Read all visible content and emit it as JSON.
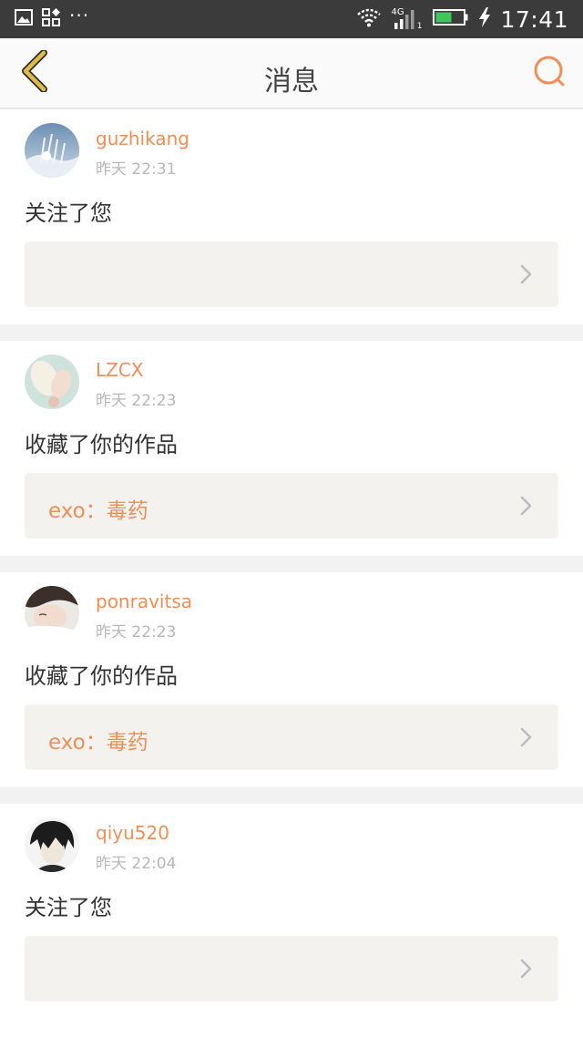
{
  "status_bar": {
    "time": "17:41",
    "dots": "···",
    "network": "4G",
    "sim": "1"
  },
  "header": {
    "title": "消息"
  },
  "messages": [
    {
      "username": "guzhikang",
      "time": "昨天 22:31",
      "action": "关注了您",
      "work_title": ""
    },
    {
      "username": "LZCX",
      "time": "昨天 22:23",
      "action": "收藏了你的作品",
      "work_title": "exo：毒药"
    },
    {
      "username": "ponravitsa",
      "time": "昨天 22:23",
      "action": "收藏了你的作品",
      "work_title": "exo：毒药"
    },
    {
      "username": "qiyu520",
      "time": "昨天 22:04",
      "action": "关注了您",
      "work_title": ""
    }
  ],
  "colors": {
    "accent": "#ef8f57",
    "back_icon": "#e0b94a",
    "status_bar_bg": "#3b3b3b",
    "battery_fill": "#3cc85a",
    "card_box_bg": "#f3f2ef"
  },
  "icons": {
    "back": "chevron-left-icon",
    "search": "search-icon",
    "row_arrow": "chevron-right-icon"
  }
}
